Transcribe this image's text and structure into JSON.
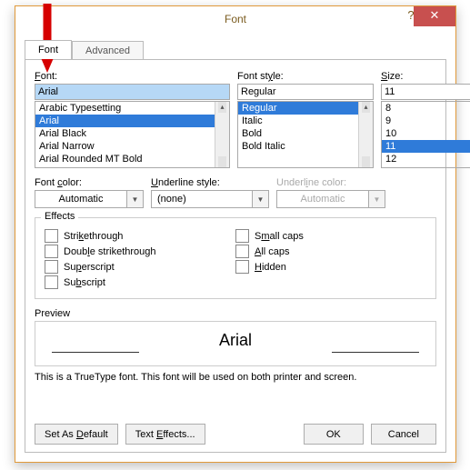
{
  "title": "Font",
  "tabs": {
    "font": "Font",
    "advanced": "Advanced"
  },
  "labels": {
    "font": "Font:",
    "style": "Font style:",
    "size": "Size:",
    "fontcolor": "Font color:",
    "underlinestyle": "Underline style:",
    "underlinecolor": "Underline color:",
    "effects": "Effects",
    "preview": "Preview"
  },
  "font": {
    "value": "Arial",
    "items": [
      "Arabic Typesetting",
      "Arial",
      "Arial Black",
      "Arial Narrow",
      "Arial Rounded MT Bold"
    ],
    "selectedIndex": 1
  },
  "style": {
    "value": "Regular",
    "items": [
      "Regular",
      "Italic",
      "Bold",
      "Bold Italic"
    ],
    "selectedIndex": 0
  },
  "size": {
    "value": "11",
    "items": [
      "8",
      "9",
      "10",
      "11",
      "12"
    ],
    "selectedIndex": 3
  },
  "fontcolor": {
    "value": "Automatic"
  },
  "underlinestyle": {
    "value": "(none)"
  },
  "underlinecolor": {
    "value": "Automatic"
  },
  "effects": {
    "strikethrough": "Strikethrough",
    "double_strikethrough": "Double strikethrough",
    "superscript": "Superscript",
    "subscript": "Subscript",
    "small_caps": "Small caps",
    "all_caps": "All caps",
    "hidden": "Hidden"
  },
  "underline_letters": {
    "strike": "K",
    "dstrike": "l",
    "super": "p",
    "sub": "b",
    "small": "m",
    "all": "A",
    "hidden": "H",
    "fontcolor": "c",
    "ustyle": "U",
    "ucolor": "I",
    "setdef": "D",
    "texteff": "e"
  },
  "preview_text": "Arial",
  "hint": "This is a TrueType font. This font will be used on both printer and screen.",
  "buttons": {
    "set_default": "Set As Default",
    "text_effects": "Text Effects...",
    "ok": "OK",
    "cancel": "Cancel"
  }
}
